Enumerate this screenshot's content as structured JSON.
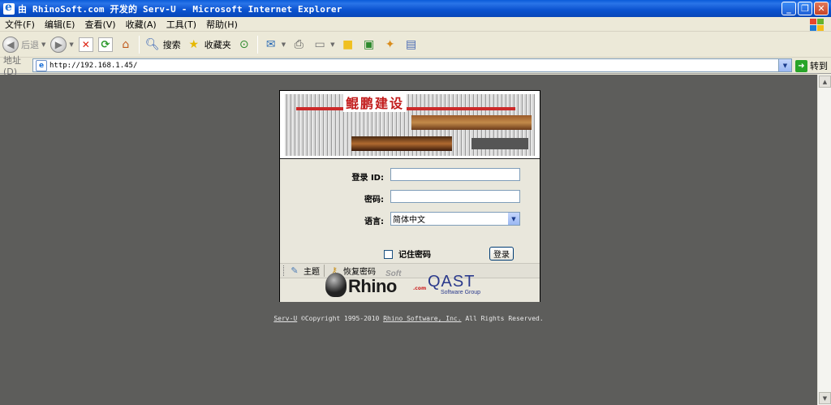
{
  "window": {
    "title": "由 RhinoSoft.com 开发的 Serv-U - Microsoft Internet Explorer",
    "minimize": "_",
    "restore": "❐",
    "close": "✕"
  },
  "menu": {
    "file": "文件(F)",
    "edit": "编辑(E)",
    "view": "查看(V)",
    "favorites": "收藏(A)",
    "tools": "工具(T)",
    "help": "帮助(H)"
  },
  "toolbar": {
    "back": "后退",
    "search": "搜索",
    "favorites": "收藏夹"
  },
  "address": {
    "label": "地址(D)",
    "url": "http://192.168.1.45/",
    "go": "转到"
  },
  "banner": {
    "headline": "鲲鹏建设"
  },
  "login": {
    "id_label": "登录 ID:",
    "password_label": "密码:",
    "language_label": "语言:",
    "language_value": "简体中文",
    "remember_label": "记住密码",
    "login_button": "登录"
  },
  "links": {
    "theme": "主题",
    "recover": "恢复密码"
  },
  "logos": {
    "rhino": "Rhino",
    "rhino_soft": "Soft",
    "rhino_com": ".com",
    "qast": "QAST",
    "qast_sub": "Software Group"
  },
  "footer": {
    "servu": "Serv-U",
    "copyright": " ©Copyright 1995-2010 ",
    "company": "Rhino Software, Inc.",
    "rights": " All Rights Reserved."
  },
  "colors": {
    "page_background": "#5d5d5b",
    "titlebar": "#0a52cf",
    "panel": "#e9e7dc"
  }
}
